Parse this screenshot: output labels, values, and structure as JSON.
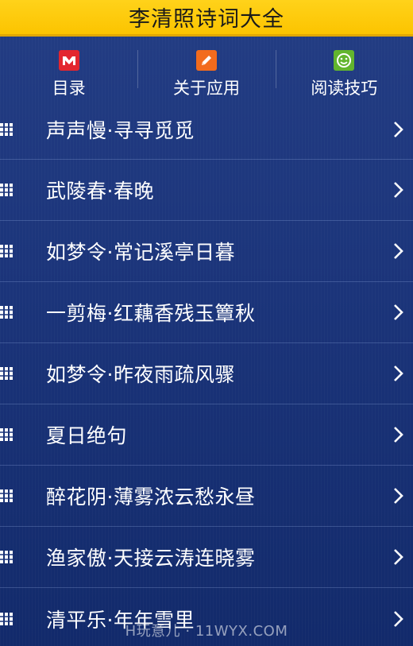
{
  "header": {
    "title": "李清照诗词大全"
  },
  "toolbar": {
    "items": [
      {
        "label": "目录",
        "icon": "m-logo-icon",
        "color": "#e3262f"
      },
      {
        "label": "关于应用",
        "icon": "pencil-icon",
        "color": "#f26b1d"
      },
      {
        "label": "阅读技巧",
        "icon": "smiley-icon",
        "color": "#62b52e"
      }
    ]
  },
  "list": {
    "items": [
      {
        "title": "声声慢·寻寻觅觅"
      },
      {
        "title": "武陵春·春晚"
      },
      {
        "title": "如梦令·常记溪亭日暮"
      },
      {
        "title": "一剪梅·红藕香残玉簟秋"
      },
      {
        "title": "如梦令·昨夜雨疏风骤"
      },
      {
        "title": "夏日绝句"
      },
      {
        "title": "醉花阴·薄雾浓云愁永昼"
      },
      {
        "title": "渔家傲·天接云涛连晓雾"
      },
      {
        "title": "清平乐·年年雪里"
      }
    ]
  },
  "watermark": "H玩意儿 · 11WYX.COM",
  "colors": {
    "header_bg": "#fcc400",
    "list_bg": "#1b347a",
    "text": "#ffffff"
  }
}
